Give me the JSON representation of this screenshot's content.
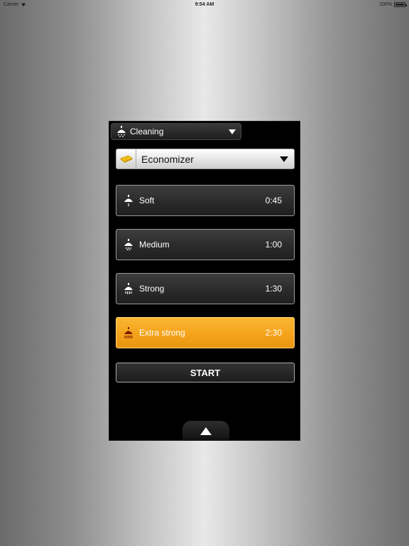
{
  "status_bar": {
    "carrier": "Carrier",
    "time": "9:54 AM",
    "battery": "100%"
  },
  "category": {
    "label": "Cleaning",
    "icon": "shower-icon"
  },
  "program": {
    "label": "Economizer",
    "icon": "sponge-icon"
  },
  "options": [
    {
      "name": "Soft",
      "time": "0:45",
      "selected": false,
      "icon": "shower-icon"
    },
    {
      "name": "Medium",
      "time": "1:00",
      "selected": false,
      "icon": "shower-icon"
    },
    {
      "name": "Strong",
      "time": "1:30",
      "selected": false,
      "icon": "shower-icon"
    },
    {
      "name": "Extra strong",
      "time": "2:30",
      "selected": true,
      "icon": "shower-icon"
    }
  ],
  "start_button": {
    "label": "START"
  },
  "expand_tab": {
    "icon": "chevron-up-icon"
  },
  "colors": {
    "accent": "#F4A31B",
    "panel": "#000000",
    "icon_dark": "#7a1f00"
  }
}
